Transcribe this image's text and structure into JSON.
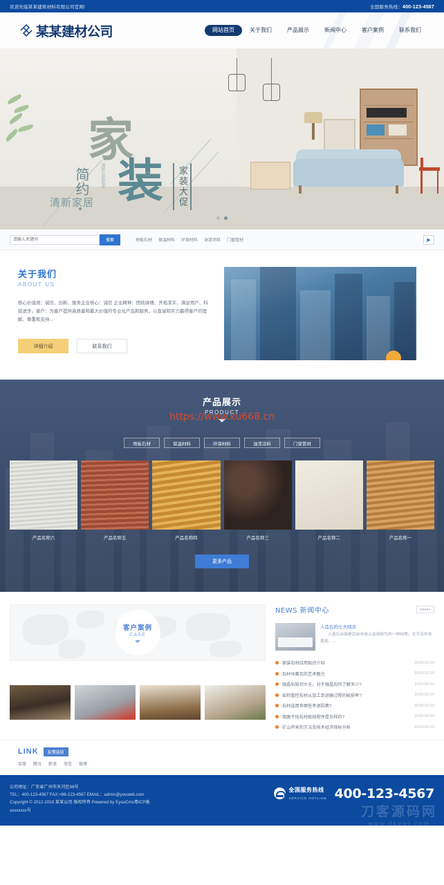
{
  "topbar": {
    "welcome": "欢迎光临某某建筑材料有限公司官网!",
    "hotline_label": "全国服务热线：",
    "hotline_number": "400-123-4567"
  },
  "header": {
    "logo_text": "某某建材公司",
    "logo_icon": "diamond-knot-logo-icon",
    "nav": [
      {
        "label": "网站首页",
        "active": true
      },
      {
        "label": "关于我们",
        "active": false
      },
      {
        "label": "产品展示",
        "active": false
      },
      {
        "label": "新闻中心",
        "active": false
      },
      {
        "label": "客户案例",
        "active": false
      },
      {
        "label": "联系我们",
        "active": false
      }
    ]
  },
  "banner": {
    "headline_big_1": "家",
    "headline_big_2": "装",
    "vertical_text": "简约",
    "sub_text": "清新家居",
    "jp_text": "清新な家居家",
    "promo_text": "家装大促",
    "slide_dots": 2,
    "active_dot": 2
  },
  "search": {
    "placeholder": "请输入关键词",
    "button_label": "搜索",
    "keywords": [
      "地板石材",
      "保温材料",
      "环保材料",
      "油漆涂料",
      "门窗管材"
    ],
    "next_arrow": "▶"
  },
  "about": {
    "title_cn": "关于我们",
    "title_en": "ABOUT US",
    "paragraph": "核心价值观：诚信、创新、服务企业核心：诚信 企业精神：团结拼搏、开拓求实、满足用户、科技进步。客户：为客户提供高质量和最大价值的专业化产品和服务，以直诚和实力赢得客户的理解、尊重和支持...",
    "btn_detail": "详细介绍",
    "btn_contact": "联系我们"
  },
  "product": {
    "title_cn": "产品展示",
    "title_en": "PRODUCT",
    "watermark": "https://www.ku668.cn",
    "tabs": [
      "地板石材",
      "保温材料",
      "环保材料",
      "油漆涂料",
      "门窗管材"
    ],
    "items": [
      {
        "name": "产品名称六",
        "color": "#dcdcd8"
      },
      {
        "name": "产品名称五",
        "color": "#b2604a"
      },
      {
        "name": "产品名称四",
        "color": "#d9a341"
      },
      {
        "name": "产品名称三",
        "color": "#3a2e2a"
      },
      {
        "name": "产品名称二",
        "color": "#e3ddd2"
      },
      {
        "name": "产品名称一",
        "color": "#c98f4e"
      }
    ],
    "more_label": "更多产品"
  },
  "case": {
    "title_cn": "客户案例",
    "title_en": "CASE",
    "thumbs": [
      {
        "color": "#8b7556"
      },
      {
        "color": "#b9bec4"
      },
      {
        "color": "#a5886a"
      },
      {
        "color": "#cbc4b4"
      }
    ]
  },
  "news": {
    "title": "NEWS 新闻中心",
    "more_label": "more+",
    "featured": {
      "title": "人造石的七大特点",
      "desc": "人造石台面是目前市场上运用较为的一种材质。它不仅外形美观，..."
    },
    "list": [
      {
        "title": "家装石材应用知识介绍",
        "date": "2019-03-19"
      },
      {
        "title": "石材马赛克的艺术魅力",
        "date": "2019-03-19"
      },
      {
        "title": "微晶石知识大全，对于微晶石你了解多少?",
        "date": "2019-03-19"
      },
      {
        "title": "如何管控石材从加工到运输过程的破损率?",
        "date": "2019-03-19"
      },
      {
        "title": "石材选用有哪些考虑因素?",
        "date": "2019-03-19"
      },
      {
        "title": "墙面干挂石材故线程序是怎样的?",
        "date": "2019-03-19"
      },
      {
        "title": "矿山开采的方法及技术经济指标分析",
        "date": "2019-03-19"
      }
    ]
  },
  "links": {
    "title_en": "LINK",
    "tag": "友情链接",
    "items": [
      "百度",
      "腾讯",
      "新浪",
      "淘宝",
      "微博"
    ]
  },
  "footer": {
    "address": "公司地址：广东省广州市天河区88号",
    "contact": "TEL：400-123-4567 FAX:+86-123-4567 EMAIL：admin@youweb.com",
    "copyright": "Copyright © 2012-2018 某某公司 版权所有 Powered by EyouCms粤ICP备",
    "icp": "xxxxxxxx号",
    "hotline_cn": "全国服务热线",
    "hotline_en": "SERVICE HOTLINE",
    "hotline_number": "400-123-4567",
    "phone_icon": "telephone-icon",
    "watermark_big": "刀客源码网",
    "watermark_small": "www.dkewl.com"
  },
  "colors": {
    "brand_blue": "#0b4a9e",
    "accent_blue": "#2f74d0",
    "accent_yellow": "#f5cf77",
    "dot_orange": "#f07c2b",
    "watermark_red": "#e14b2e"
  }
}
